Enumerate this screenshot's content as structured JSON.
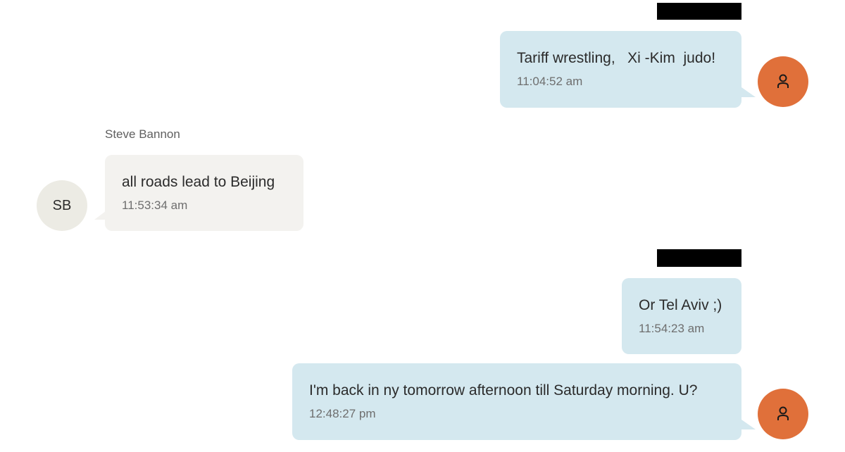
{
  "colors": {
    "outgoing_bubble": "#d4e8ef",
    "incoming_bubble": "#f3f2ef",
    "self_avatar": "#e0703a",
    "other_avatar": "#ecebe4",
    "redaction": "#000000"
  },
  "messages": [
    {
      "direction": "outgoing",
      "text": "Tariff wrestling,   Xi -Kim  judo!",
      "time": "11:04:52 am",
      "avatar_icon": "person-icon"
    },
    {
      "direction": "incoming",
      "sender": "Steve Bannon",
      "avatar_initials": "SB",
      "text": "all roads lead to Beijing",
      "time": "11:53:34 am"
    },
    {
      "direction": "outgoing",
      "text": "Or Tel Aviv ;)",
      "time": "11:54:23 am"
    },
    {
      "direction": "outgoing",
      "text": "I'm back in ny tomorrow afternoon till Saturday morning. U?",
      "time": "12:48:27 pm",
      "avatar_icon": "person-icon"
    }
  ]
}
